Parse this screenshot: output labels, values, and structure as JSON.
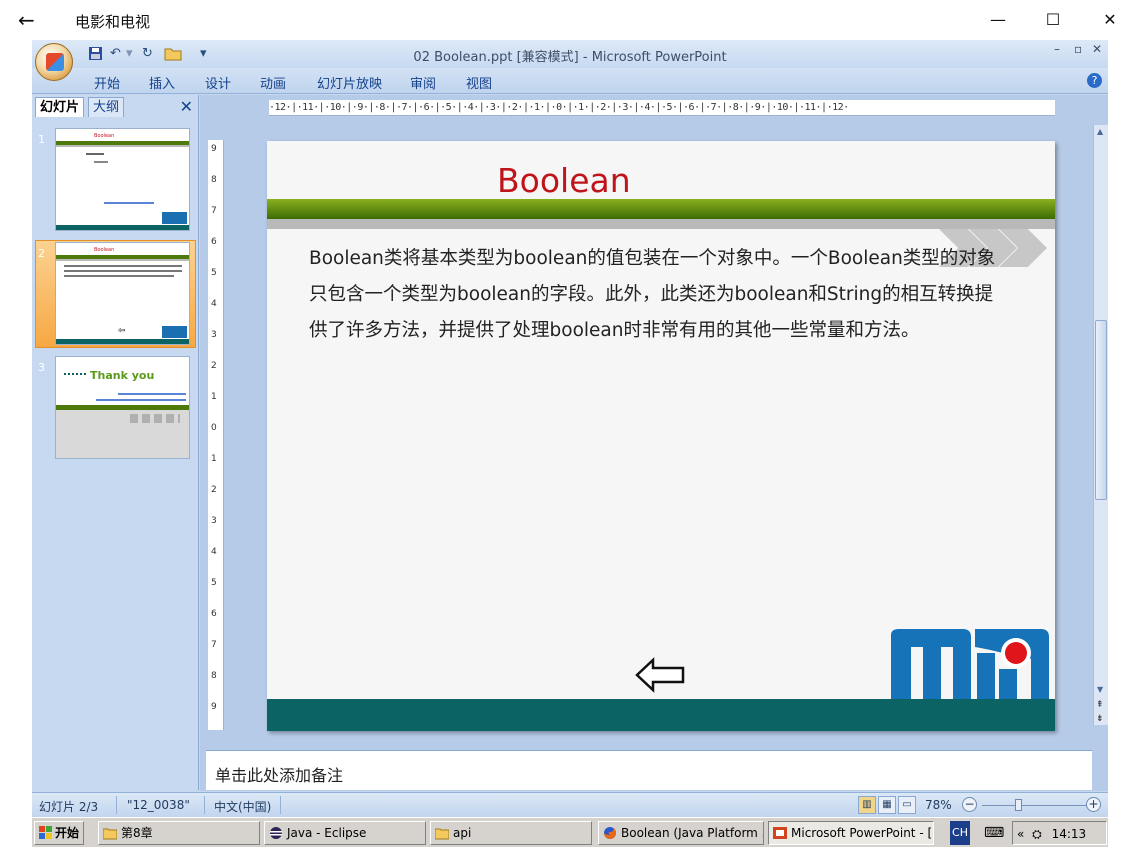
{
  "outer_window": {
    "back_icon": "←",
    "title": "电影和电视",
    "minimize": "—",
    "maximize": "☐",
    "close": "✕"
  },
  "ppt": {
    "caption": "02 Boolean.ppt [兼容模式] - Microsoft PowerPoint",
    "ribbon_tabs": [
      "开始",
      "插入",
      "设计",
      "动画",
      "幻灯片放映",
      "审阅",
      "视图"
    ],
    "help": "?"
  },
  "left_panel": {
    "tab_slides": "幻灯片",
    "tab_outline": "大纲",
    "close": "✕",
    "thumbs": [
      {
        "num": "1",
        "title": "Boolean",
        "thank": ""
      },
      {
        "num": "2",
        "title": "Boolean",
        "thank": ""
      },
      {
        "num": "3",
        "title": "",
        "thank": "Thank you"
      }
    ]
  },
  "ruler": {
    "horizontal": "·12·|·11·|·10·|·9·|·8·|·7·|·6·|·5·|·4·|·3·|·2·|·1·|·0·|·1·|·2·|·3·|·4·|·5·|·6·|·7·|·8·|·9·|·10·|·11·|·12·",
    "vertical": [
      "9",
      "8",
      "7",
      "6",
      "5",
      "4",
      "3",
      "2",
      "1",
      "0",
      "1",
      "2",
      "3",
      "4",
      "5",
      "6",
      "7",
      "8",
      "9"
    ]
  },
  "slide": {
    "title": "Boolean",
    "body": "Boolean类将基本类型为boolean的值包装在一个对象中。一个Boolean类型的对象只包含一个类型为boolean的字段。此外，此类还为boolean和String的相互转换提供了许多方法，并提供了处理boolean时非常有用的其他一些常量和方法。"
  },
  "notes": {
    "placeholder": "单击此处添加备注"
  },
  "statusbar": {
    "slide_pos": "幻灯片 2/3",
    "theme": "\"12_0038\"",
    "language": "中文(中国)",
    "zoom": "78%",
    "zoom_out": "−",
    "zoom_in": "+"
  },
  "taskbar": {
    "start": "开始",
    "tasks": [
      {
        "label": "第8章",
        "icon": "folder-icon"
      },
      {
        "label": "Java - Eclipse",
        "icon": "eclipse-icon"
      },
      {
        "label": "api",
        "icon": "folder-icon"
      },
      {
        "label": "Boolean (Java Platform ...",
        "icon": "firefox-icon"
      },
      {
        "label": "Microsoft PowerPoint - [...",
        "icon": "powerpoint-icon"
      }
    ],
    "ime": "CH",
    "clock": "14:13"
  }
}
